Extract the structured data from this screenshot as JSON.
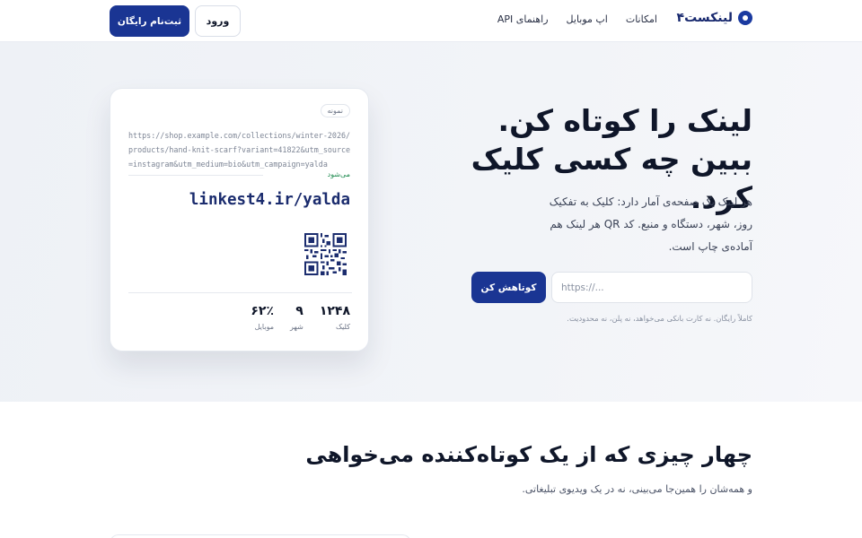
{
  "nav": {
    "brand": "لینکست۴",
    "links": [
      "امکانات",
      "اپ موبایل",
      "راهنمای API"
    ],
    "login_label": "ورود",
    "signup_label": "ثبت‌نام رایگان"
  },
  "hero": {
    "headline_line1": "لینک را کوتاه کن.",
    "headline_line2": "ببین چه کسی کلیک کرد.",
    "description": "هر لینک یک صفحه‌ی آمار دارد: کلیک به تفکیک روز، شهر، دستگاه و منبع. کد QR هر لینک هم آماده‌ی چاپ است.",
    "input_placeholder": "https://...",
    "shorten_label": "کوتاهش کن",
    "note": "کاملاً رایگان. نه کارت بانکی می‌خواهد، نه پلن، نه محدودیت."
  },
  "sample_card": {
    "badge": "نمونه",
    "long_url": "https://shop.example.com/collections/winter-2026/products/hand-knit-scarf?variant=41822&utm_source=instagram&utm_medium=bio&utm_campaign=yalda",
    "becomes_label": "می‌شود",
    "short_url": "linkest4.ir/yalda",
    "stats": [
      {
        "value": "۱۲۴۸",
        "label": "کلیک"
      },
      {
        "value": "۹",
        "label": "شهر"
      },
      {
        "value": "۶۲٪",
        "label": "موبایل"
      }
    ]
  },
  "features": {
    "title": "چهار چیزی که از یک کوتاه‌کننده می‌خواهی",
    "subtitle": "و همه‌شان را همین‌جا می‌بینی، نه در یک ویدیوی تبلیغاتی."
  },
  "colors": {
    "primary": "#1a3593",
    "brand_text": "#17286e",
    "success": "#1c8a4e",
    "hero_bg": "#eef1f6"
  },
  "icons": {
    "logo": "gear-logo-icon",
    "qr": "qr-code-icon"
  }
}
